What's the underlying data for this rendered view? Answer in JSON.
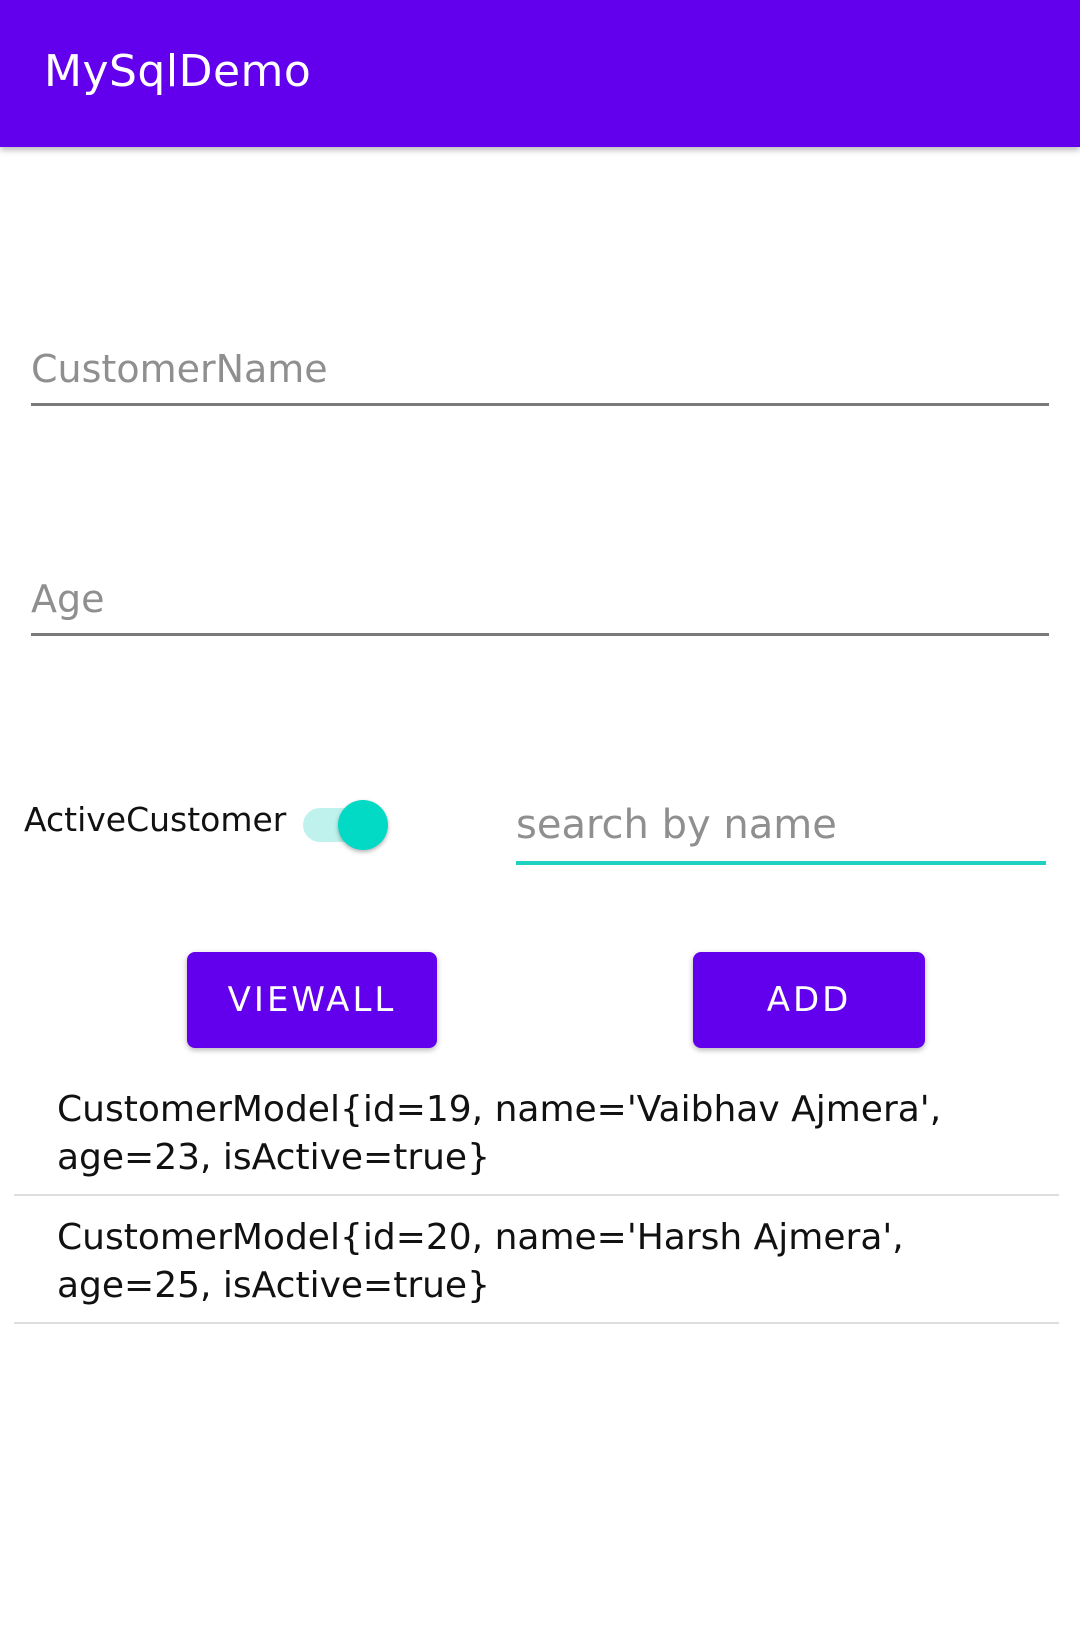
{
  "app_bar": {
    "title": "MySqlDemo",
    "color": "#6200ee"
  },
  "form": {
    "customer_name": {
      "value": "",
      "placeholder": "CustomerName"
    },
    "age": {
      "value": "",
      "placeholder": "Age"
    },
    "active_customer": {
      "label": "ActiveCustomer",
      "checked": true,
      "accent_color": "#03dac5"
    },
    "search": {
      "value": "",
      "placeholder": "search by name"
    }
  },
  "buttons": {
    "view_all_label": "VIEWALL",
    "add_label": "ADD"
  },
  "customer_list": [
    {
      "text": "CustomerModel{id=19, name='Vaibhav Ajmera', age=23, isActive=true}"
    },
    {
      "text": "CustomerModel{id=20, name='Harsh Ajmera', age=25, isActive=true}"
    }
  ]
}
